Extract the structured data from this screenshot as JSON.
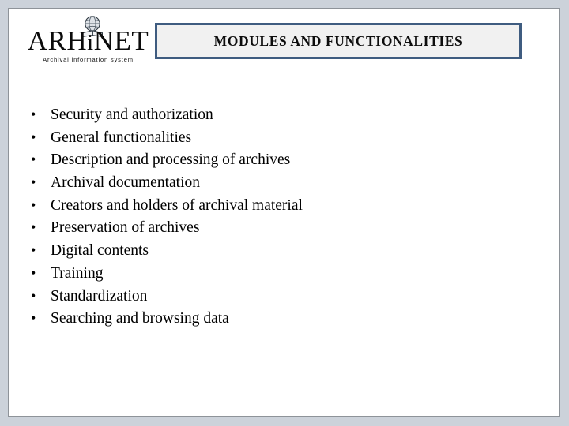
{
  "slide": {
    "background_color": "#ffffff",
    "page_background_color": "#ccd2da"
  },
  "logo": {
    "icon": "globe-on-book-icon",
    "wordmark_part1": "ARH",
    "wordmark_part2": "i",
    "wordmark_part3": "NET",
    "tagline": "Archival information system"
  },
  "title": {
    "text": "MODULES AND FUNCTIONALITIES",
    "border_color": "#3f5c80",
    "fill_color": "#f1f1f1"
  },
  "bullets": {
    "marker": "•",
    "items": [
      {
        "label": "Security and authorization"
      },
      {
        "label": "General functionalities"
      },
      {
        "label": "Description and processing of archives"
      },
      {
        "label": "Archival documentation"
      },
      {
        "label": "Creators and holders of archival material"
      },
      {
        "label": "Preservation of archives"
      },
      {
        "label": "Digital contents"
      },
      {
        "label": "Training"
      },
      {
        "label": "Standardization"
      },
      {
        "label": "Searching and browsing data"
      }
    ]
  }
}
